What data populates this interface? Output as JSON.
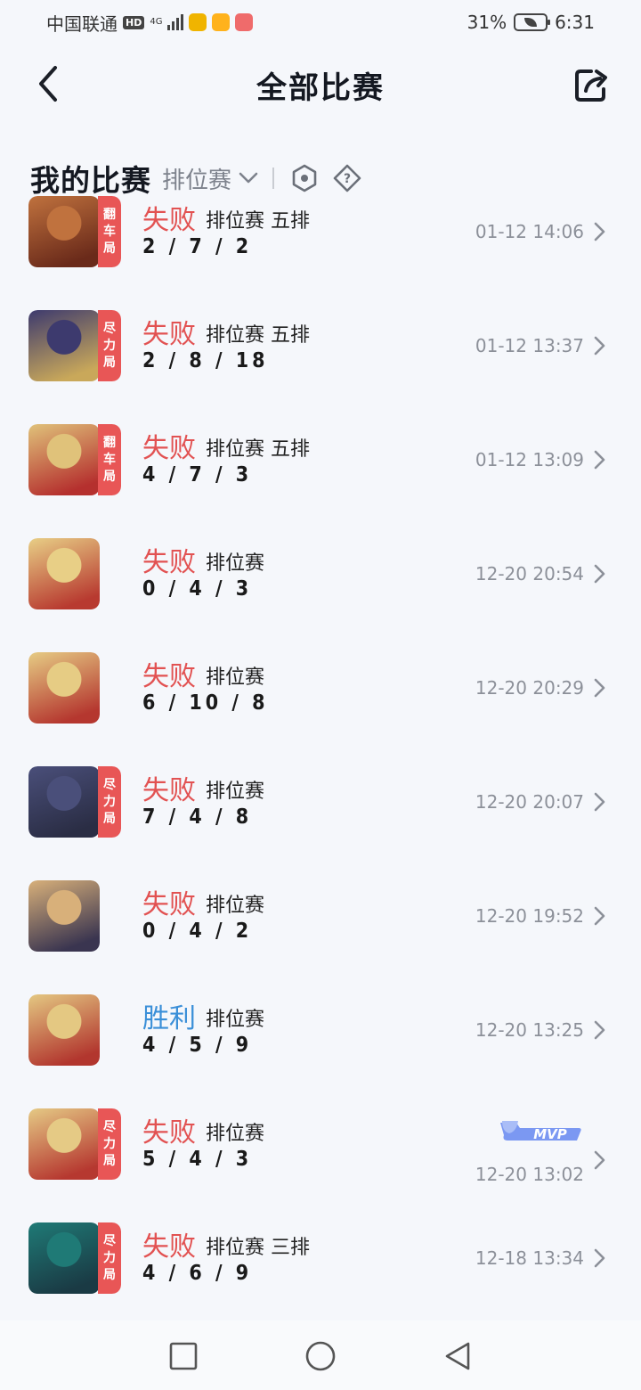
{
  "status_bar": {
    "carrier": "中国联通",
    "hd": "HD",
    "network": "4G",
    "battery": "31%",
    "time": "6:31"
  },
  "header": {
    "title": "全部比赛"
  },
  "section": {
    "title": "我的比赛",
    "filter": "排位赛"
  },
  "matches": [
    {
      "result": "失败",
      "mode": "排位赛 五排",
      "kda": "2 / 7 / 2",
      "time": "01-12 14:06",
      "tag": [
        "翻",
        "车",
        "局"
      ]
    },
    {
      "result": "失败",
      "mode": "排位赛 五排",
      "kda": "2 / 8 / 18",
      "time": "01-12 13:37",
      "tag": [
        "尽",
        "力",
        "局"
      ]
    },
    {
      "result": "失败",
      "mode": "排位赛 五排",
      "kda": "4 / 7 / 3",
      "time": "01-12 13:09",
      "tag": [
        "翻",
        "车",
        "局"
      ]
    },
    {
      "result": "失败",
      "mode": "排位赛",
      "kda": "0 / 4 / 3",
      "time": "12-20 20:54",
      "tag": []
    },
    {
      "result": "失败",
      "mode": "排位赛",
      "kda": "6 / 10 / 8",
      "time": "12-20 20:29",
      "tag": []
    },
    {
      "result": "失败",
      "mode": "排位赛",
      "kda": "7 / 4 / 8",
      "time": "12-20 20:07",
      "tag": [
        "尽",
        "力",
        "局"
      ]
    },
    {
      "result": "失败",
      "mode": "排位赛",
      "kda": "0 / 4 / 2",
      "time": "12-20 19:52",
      "tag": []
    },
    {
      "result": "胜利",
      "mode": "排位赛",
      "kda": "4 / 5 / 9",
      "time": "12-20 13:25",
      "tag": []
    },
    {
      "result": "失败",
      "mode": "排位赛",
      "kda": "5 / 4 / 3",
      "time": "12-20 13:02",
      "tag": [
        "尽",
        "力",
        "局"
      ],
      "mvp": "MVP"
    },
    {
      "result": "失败",
      "mode": "排位赛 三排",
      "kda": "4 / 6 / 9",
      "time": "12-18 13:34",
      "tag": [
        "尽",
        "力",
        "局"
      ]
    }
  ],
  "colors": {
    "loss": "#e25252",
    "win": "#3a8fd8",
    "tag_bg": "#e85656",
    "mvp": "#6b8df0"
  },
  "icons": {
    "back": "chevron-left-icon",
    "share": "share-export-icon",
    "filter": "chevron-down-icon",
    "hex": "hexagon-settings-icon",
    "help": "diamond-question-icon",
    "row": "chevron-right-icon"
  }
}
